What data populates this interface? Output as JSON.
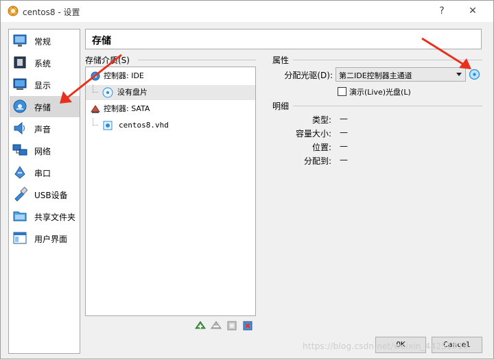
{
  "window": {
    "title": "centos8 - 设置",
    "help": "?",
    "close": "✕"
  },
  "sidebar": {
    "items": [
      {
        "label": "常规",
        "icon": "general-icon"
      },
      {
        "label": "系统",
        "icon": "system-icon"
      },
      {
        "label": "显示",
        "icon": "display-icon"
      },
      {
        "label": "存储",
        "icon": "storage-icon",
        "active": true
      },
      {
        "label": "声音",
        "icon": "audio-icon"
      },
      {
        "label": "网络",
        "icon": "network-icon"
      },
      {
        "label": "串口",
        "icon": "serial-port-icon"
      },
      {
        "label": "USB设备",
        "icon": "usb-icon"
      },
      {
        "label": "共享文件夹",
        "icon": "shared-folder-icon"
      },
      {
        "label": "用户界面",
        "icon": "user-interface-icon"
      }
    ]
  },
  "header": {
    "title": "存储"
  },
  "storage": {
    "media_label": "存储介质(S)",
    "tree": [
      {
        "label": "控制器: IDE",
        "type": "controller"
      },
      {
        "label": "没有盘片",
        "type": "optical"
      },
      {
        "label": "控制器: SATA",
        "type": "controller"
      },
      {
        "label": "centos8.vhd",
        "type": "disk"
      }
    ]
  },
  "attributes": {
    "title": "属性",
    "drive_label": "分配光驱(D):",
    "drive_value": "第二IDE控制器主通道",
    "live_cd_label": "演示(Live)光盘(L)"
  },
  "details": {
    "title": "明细",
    "rows": [
      {
        "label": "类型:",
        "value": "—"
      },
      {
        "label": "容量大小:",
        "value": "—"
      },
      {
        "label": "位置:",
        "value": "—"
      },
      {
        "label": "分配到:",
        "value": "—"
      }
    ]
  },
  "buttons": {
    "ok": "OK",
    "cancel": "Cancel"
  },
  "watermark": "https://blog.csdn.net/weixin_44251016",
  "colors": {
    "arrow": "#e8301c",
    "accent": "#2a8fd6"
  }
}
